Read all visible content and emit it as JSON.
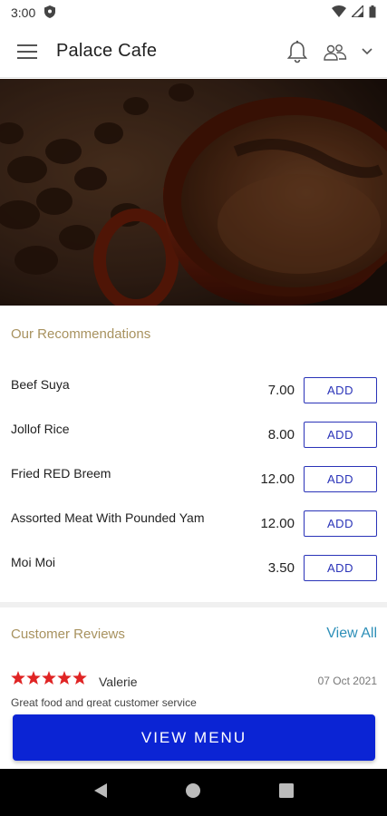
{
  "status_bar": {
    "time": "3:00",
    "icons": [
      "shield-icon",
      "wifi-icon",
      "signal-icon",
      "battery-icon"
    ]
  },
  "app_bar": {
    "title": "Palace Cafe",
    "icons": [
      "hamburger-menu-icon",
      "bell-icon",
      "account-switch-icon",
      "chevron-down-icon"
    ]
  },
  "hero": {
    "image_description": "coffee-cup-and-beans-photo"
  },
  "recommendations": {
    "title": "Our Recommendations",
    "items": [
      {
        "name": "Beef Suya",
        "price": "7.00",
        "button": "ADD"
      },
      {
        "name": "Jollof Rice",
        "price": "8.00",
        "button": "ADD"
      },
      {
        "name": "Fried RED Breem",
        "price": "12.00",
        "button": "ADD"
      },
      {
        "name": "Assorted Meat With Pounded Yam",
        "price": "12.00",
        "button": "ADD"
      },
      {
        "name": "Moi Moi",
        "price": "3.50",
        "button": "ADD"
      }
    ]
  },
  "reviews": {
    "title": "Customer Reviews",
    "view_all": "View All",
    "items": [
      {
        "stars": 5,
        "reviewer": "Valerie",
        "date": "07 Oct 2021",
        "text": "Great food and great customer service"
      }
    ]
  },
  "cta": {
    "label": "VIEW MENU"
  },
  "colors": {
    "accent_gold": "#a8925f",
    "button_blue": "#0b24d4",
    "outline_blue": "#2a33b8",
    "link_blue": "#2d8fb8",
    "star_red": "#e02424"
  }
}
